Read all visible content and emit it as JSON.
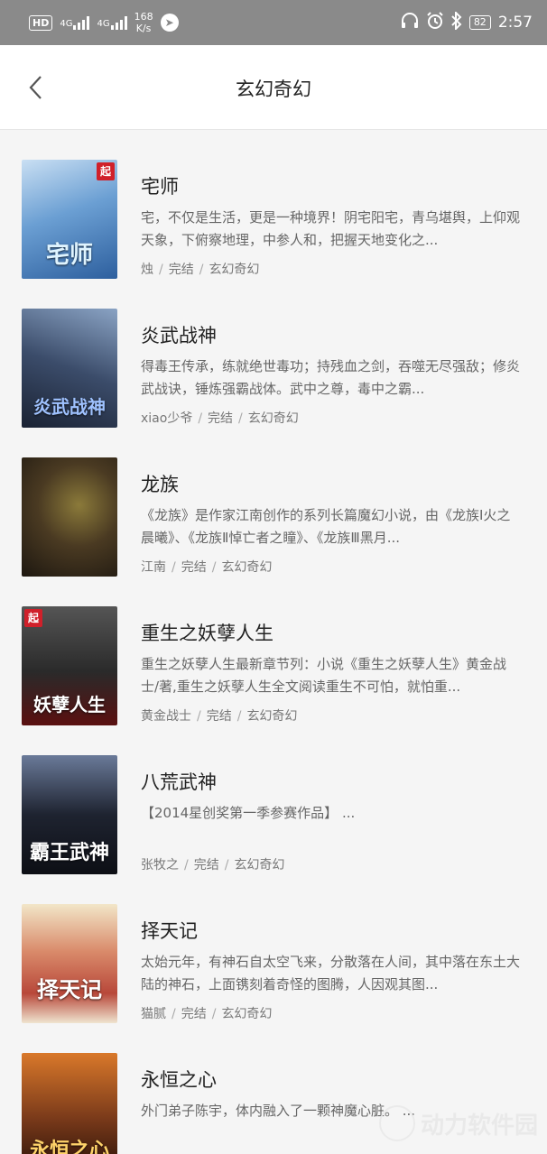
{
  "status_bar": {
    "hd": "HD",
    "net1": "4G",
    "net2": "4G",
    "speed_value": "168",
    "speed_unit": "K/s",
    "battery": "82",
    "time": "2:57",
    "icons": [
      "headphones-icon",
      "alarm-icon",
      "bluetooth-icon"
    ]
  },
  "header": {
    "title": "玄幻奇幻"
  },
  "books": [
    {
      "title": "宅师",
      "desc": "宅，不仅是生活，更是一种境界！阴宅阳宅，青乌堪舆，上仰观天象，下俯察地理，中参人和，把握天地变化之...",
      "author": "烛",
      "status": "完结",
      "category": "玄幻奇幻",
      "cover_text": "宅师",
      "cover_badge": "起",
      "cover_color": "#5a8fc8"
    },
    {
      "title": "炎武战神",
      "desc": "得毒王传承，练就绝世毒功；持残血之剑，吞噬无尽强敌；修炎武战诀，锤炼强霸战体。武中之尊，毒中之霸...",
      "author": "xiao少爷",
      "status": "完结",
      "category": "玄幻奇幻",
      "cover_text": "炎武战神",
      "cover_badge": "",
      "cover_color": "#3b4c6a"
    },
    {
      "title": "龙族",
      "desc": "《龙族》是作家江南创作的系列长篇魔幻小说，由《龙族Ⅰ火之晨曦》、《龙族Ⅱ悼亡者之瞳》、《龙族Ⅲ黑月...",
      "author": "江南",
      "status": "完结",
      "category": "玄幻奇幻",
      "cover_text": "",
      "cover_badge": "",
      "cover_color": "#4a3a22"
    },
    {
      "title": "重生之妖孽人生",
      "desc": "重生之妖孽人生最新章节列：小说《重生之妖孽人生》黄金战士/著,重生之妖孽人生全文阅读重生不可怕，就怕重...",
      "author": "黄金战士",
      "status": "完结",
      "category": "玄幻奇幻",
      "cover_text": "妖孽人生",
      "cover_badge": "起",
      "cover_color": "#2a2a2a"
    },
    {
      "title": "八荒武神",
      "desc": "【2014星创奖第一季参赛作品】 ...",
      "author": "张牧之",
      "status": "完结",
      "category": "玄幻奇幻",
      "cover_text": "霸王武神",
      "cover_badge": "",
      "cover_color": "#1e2330"
    },
    {
      "title": "择天记",
      "desc": "太始元年，有神石自太空飞来，分散落在人间，其中落在东土大陆的神石，上面镌刻着奇怪的图腾，人因观其图...",
      "author": "猫腻",
      "status": "完结",
      "category": "玄幻奇幻",
      "cover_text": "择天记",
      "cover_badge": "",
      "cover_color": "#b8483a"
    },
    {
      "title": "永恒之心",
      "desc": "外门弟子陈宇，体内融入了一颗神魔心脏。 ...",
      "author": "",
      "status": "",
      "category": "",
      "cover_text": "永恒之心",
      "cover_badge": "",
      "cover_color": "#7a3a1a"
    }
  ],
  "watermark": {
    "text": "动力软件园"
  }
}
